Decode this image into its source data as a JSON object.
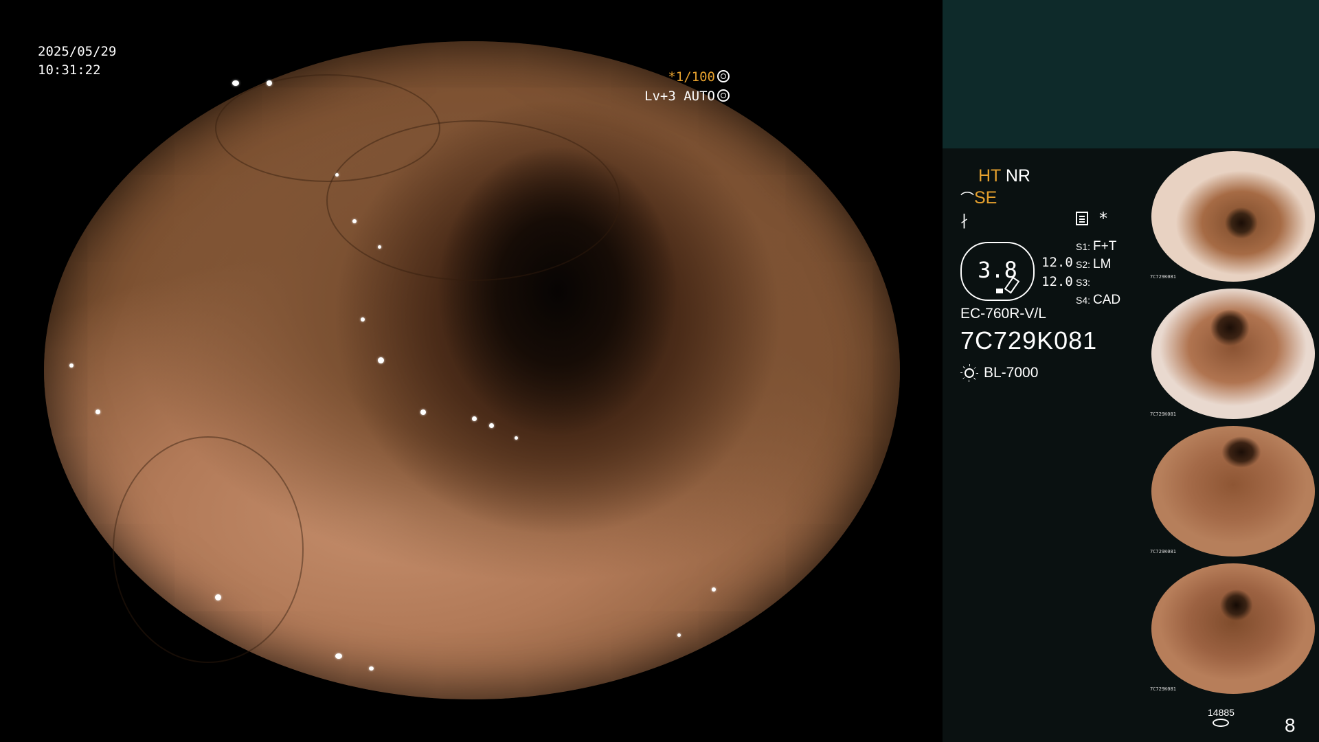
{
  "osd": {
    "date": "2025/05/29",
    "time": "10:31:22",
    "shutter": "*1/100",
    "level": "Lv+3 AUTO"
  },
  "panel": {
    "ht": "HT",
    "nr": "NR",
    "se": "SE",
    "badge_value": "3.8",
    "badge_nums": [
      "12.0",
      "12.0"
    ],
    "settings": [
      {
        "key": "S1:",
        "value": "F+T"
      },
      {
        "key": "S2:",
        "value": "LM"
      },
      {
        "key": "S3:",
        "value": ""
      },
      {
        "key": "S4:",
        "value": "CAD"
      }
    ],
    "model": "EC-760R-V/L",
    "serial": "7C729K081",
    "lamp": "BL-7000",
    "thumb_caption": "7C729K081",
    "counter": "14885",
    "page": "8"
  },
  "colors": {
    "accent": "#e6a12e",
    "panel_bg": "#0a1111",
    "panel_top": "#0e2a2a"
  }
}
